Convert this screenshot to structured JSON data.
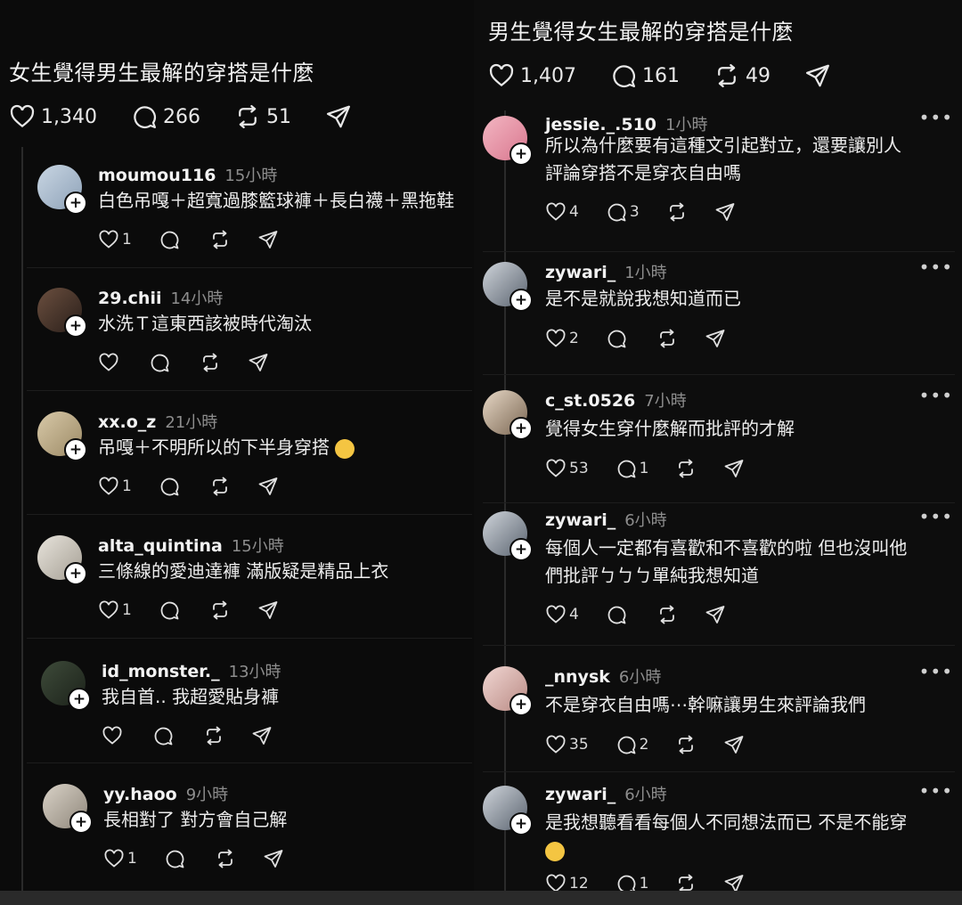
{
  "left_post": {
    "title": "女生覺得男生最解的穿搭是什麼",
    "likes": "1,340",
    "comments": "266",
    "reposts": "51",
    "replies": [
      {
        "user": "moumou116",
        "time": "15小時",
        "text": "白色吊嘎＋超寬過膝籃球褲＋長白襪＋黑拖鞋",
        "likes": "1",
        "comments": ""
      },
      {
        "user": "29.chii",
        "time": "14小時",
        "text": "水洗Ｔ這東西該被時代淘汰",
        "likes": "",
        "comments": ""
      },
      {
        "user": "xx.o_z",
        "time": "21小時",
        "text": "吊嘎＋不明所以的下半身穿搭",
        "likes": "1",
        "comments": ""
      },
      {
        "user": "alta_quintina",
        "time": "15小時",
        "text": "三條線的愛迪達褲 滿版疑是精品上衣",
        "likes": "1",
        "comments": ""
      },
      {
        "user": "id_monster._",
        "time": "13小時",
        "text": "我自首.. 我超愛貼身褲",
        "likes": "",
        "comments": ""
      },
      {
        "user": "yy.haoo",
        "time": "9小時",
        "text": "長相對了 對方會自己解",
        "likes": "1",
        "comments": ""
      }
    ]
  },
  "right_post": {
    "title": "男生覺得女生最解的穿搭是什麼",
    "likes": "1,407",
    "comments": "161",
    "reposts": "49",
    "replies": [
      {
        "user": "jessie._.510",
        "time": "1小時",
        "lines": [
          "所以為什麼要有這種文引起對立，還要讓別人",
          "評論穿搭不是穿衣自由嗎"
        ],
        "likes": "4",
        "comments": "3"
      },
      {
        "user": "zywari_",
        "time": "1小時",
        "lines": [
          "是不是就說我想知道而已"
        ],
        "likes": "2",
        "comments": ""
      },
      {
        "user": "c_st.0526",
        "time": "7小時",
        "lines": [
          "覺得女生穿什麼解而批評的才解"
        ],
        "likes": "53",
        "comments": "1"
      },
      {
        "user": "zywari_",
        "time": "6小時",
        "lines": [
          "每個人一定都有喜歡和不喜歡的啦 但也沒叫他",
          "們批評ㄅㄅㄅ單純我想知道"
        ],
        "likes": "4",
        "comments": ""
      },
      {
        "user": "_nnysk",
        "time": "6小時",
        "lines": [
          "不是穿衣自由嗎⋯幹嘛讓男生來評論我們"
        ],
        "likes": "35",
        "comments": "2"
      },
      {
        "user": "zywari_",
        "time": "6小時",
        "lines": [
          "是我想聽看看每個人不同想法而已 不是不能穿"
        ],
        "likes": "12",
        "comments": "1"
      }
    ]
  },
  "colors": {
    "background": "#0a0a0a",
    "text": "#f2f2f2",
    "muted": "#8d8d8d"
  },
  "icons": [
    "heart-icon",
    "comment-icon",
    "repost-icon",
    "share-icon",
    "plus-badge-icon",
    "more-icon"
  ]
}
